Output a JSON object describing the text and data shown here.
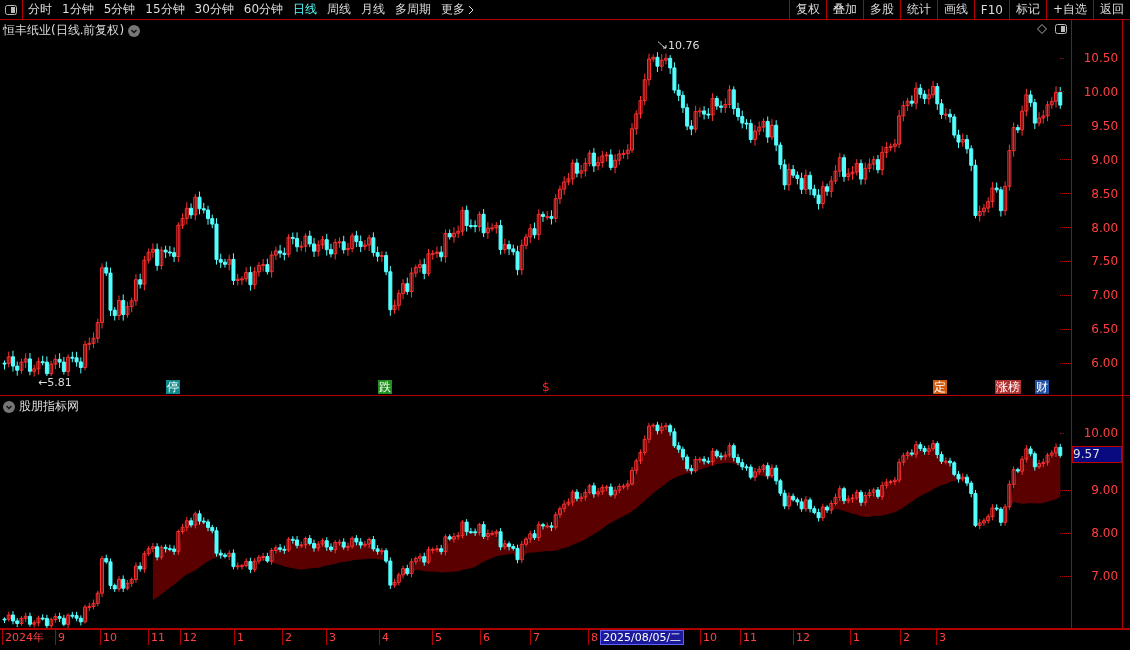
{
  "toolbar": {
    "periods": [
      {
        "label": "分时",
        "selected": false
      },
      {
        "label": "1分钟",
        "selected": false
      },
      {
        "label": "5分钟",
        "selected": false
      },
      {
        "label": "15分钟",
        "selected": false
      },
      {
        "label": "30分钟",
        "selected": false
      },
      {
        "label": "60分钟",
        "selected": false
      },
      {
        "label": "日线",
        "selected": true
      },
      {
        "label": "周线",
        "selected": false
      },
      {
        "label": "月线",
        "selected": false
      },
      {
        "label": "多周期",
        "selected": false
      }
    ],
    "more": "更多",
    "buttons": [
      "复权",
      "叠加",
      "多股",
      "统计",
      "画线",
      "F10",
      "标记",
      "+自选",
      "返回"
    ]
  },
  "main_chart": {
    "title": "恒丰纸业(日线.前复权)",
    "high_label": "10.76",
    "low_label": "←5.81",
    "y_ticks": [
      "10.50",
      "10.00",
      "9.50",
      "9.00",
      "8.50",
      "8.00",
      "7.50",
      "7.00",
      "6.50",
      "6.00"
    ],
    "markers": [
      {
        "label": "停",
        "kind": "badge",
        "color": "#0e8a8a"
      },
      {
        "label": "跌",
        "kind": "badge",
        "color": "#1f8f1f"
      },
      {
        "label": "$",
        "kind": "text",
        "color": "#ff2020"
      },
      {
        "label": "定",
        "kind": "badge",
        "color": "#d05a10"
      },
      {
        "label": "涨榜",
        "kind": "badge",
        "color": "#b03030"
      },
      {
        "label": "财",
        "kind": "badge",
        "color": "#1f4fa0"
      }
    ]
  },
  "indicator_panel": {
    "title": "股朋指标网",
    "current_value": "9.57",
    "y_ticks": [
      "10.00",
      "9.00",
      "8.00",
      "7.00"
    ]
  },
  "date_axis": {
    "labels": [
      "2024年",
      "9",
      "10",
      "11",
      "12",
      "1",
      "2",
      "3",
      "4",
      "5",
      "6",
      "7",
      "8",
      "10",
      "11",
      "12",
      "1",
      "2",
      "3"
    ],
    "cursor_date": "2025/08/05/二"
  }
}
